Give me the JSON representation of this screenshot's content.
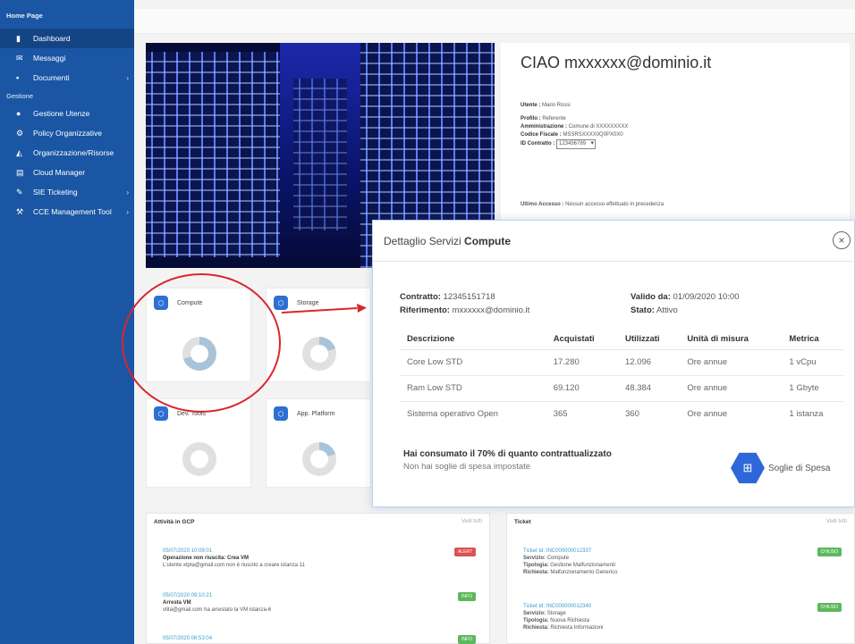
{
  "sidebar": {
    "brand": "Home Page",
    "items_top": [
      {
        "label": "Dashboard",
        "icon": "bar-chart-icon",
        "chevron": ""
      },
      {
        "label": "Messaggi",
        "icon": "envelope-icon",
        "chevron": ""
      },
      {
        "label": "Documenti",
        "icon": "document-icon",
        "chevron": "›"
      }
    ],
    "section": "Gestione",
    "items_bottom": [
      {
        "label": "Gestione Utenze",
        "icon": "user-icon",
        "chevron": ""
      },
      {
        "label": "Policy Organizzative",
        "icon": "policy-icon",
        "chevron": ""
      },
      {
        "label": "Organizzazione/Risorse",
        "icon": "org-icon",
        "chevron": ""
      },
      {
        "label": "Cloud Manager",
        "icon": "server-icon",
        "chevron": ""
      },
      {
        "label": "SIE Ticketing",
        "icon": "wrench-icon",
        "chevron": "›"
      },
      {
        "label": "CCE Management Tool",
        "icon": "tools-icon",
        "chevron": "›"
      }
    ]
  },
  "welcome": {
    "greeting": "CIAO mxxxxxx@dominio.it",
    "utente_label": "Utente :",
    "utente_value": "Mario Rossi",
    "profilo_label": "Profilo :",
    "profilo_value": "Referente",
    "amm_label": "Amministrazione :",
    "amm_value": "Comune di XXXXXXXXX",
    "cf_label": "Codice Fiscale :",
    "cf_value": "MSSRSXXXX0Q0PX0X0",
    "contratto_label": "ID Contratto :",
    "contratto_value": "123456789",
    "accesso_label": "Ultimo Accesso :",
    "accesso_value": "Nessun accesso effettuato in precedenza"
  },
  "cards": [
    {
      "title": "Compute",
      "icon": "compute-icon",
      "fill": 0.7
    },
    {
      "title": "Storage",
      "icon": "storage-icon",
      "fill": 0.2
    },
    {
      "title": "Dev. Tools",
      "icon": "dev-tools-icon",
      "fill": 0.0
    },
    {
      "title": "App. Platform",
      "icon": "app-platform-icon",
      "fill": 0.2
    }
  ],
  "activity": {
    "title": "Attività in GCP",
    "link": "Vedi tutti",
    "items": [
      {
        "when": "05/07/2020 10:09:01",
        "title": "Operazione non riuscita: Crea VM",
        "desc": "L'utente xtpta@gmail.com non è riuscito a creare istanza 11",
        "badge": "ALERT",
        "badge_color": "#d9534f"
      },
      {
        "when": "05/07/2020 09:10:21",
        "title": "Arresta VM",
        "desc": "vtita@gmail.com ha arrestato la VM istanza-6",
        "badge": "INFO",
        "badge_color": "#5cb85c"
      },
      {
        "when": "05/07/2020 08:53:04",
        "title": "",
        "desc": "",
        "badge": "INFO",
        "badge_color": "#5cb85c"
      }
    ]
  },
  "tickets": {
    "title": "Ticket",
    "link": "Vedi tutti",
    "items": [
      {
        "id": "Ticket Id: INC000000012337",
        "servizio_label": "Servizio:",
        "servizio": "Compute",
        "tipologia_label": "Tipologia:",
        "tipologia": "Gestione Malfunzionamenti",
        "richiesta_label": "Richiesta:",
        "richiesta": "Malfunzionamento Generico",
        "badge": "CHIUSO",
        "badge_color": "#5cb85c"
      },
      {
        "id": "Ticket Id: INC000000012340",
        "servizio_label": "Servizio:",
        "servizio": "Storage",
        "tipologia_label": "Tipologia:",
        "tipologia": "Nuova Richiesta",
        "richiesta_label": "Richiesta:",
        "richiesta": "Richiesta Informazioni",
        "badge": "CHIUSO",
        "badge_color": "#5cb85c"
      }
    ]
  },
  "modal": {
    "title_prefix": "Dettaglio Servizi ",
    "title_bold": "Compute",
    "close": "×",
    "contratto_label": "Contratto:",
    "contratto": "12345151718",
    "riferimento_label": "Riferimento:",
    "riferimento": "mxxxxxx@dominio.it",
    "valido_label": "Valido da:",
    "valido": "01/09/2020 10:00",
    "stato_label": "Stato:",
    "stato": "Attivo",
    "columns": [
      "Descrizione",
      "Acquistati",
      "Utilizzati",
      "Unità di misura",
      "Metrica"
    ],
    "rows": [
      [
        "Core Low STD",
        "17.280",
        "12.096",
        "Ore annue",
        "1 vCpu"
      ],
      [
        "Ram Low STD",
        "69.120",
        "48.384",
        "Ore annue",
        "1 Gbyte"
      ],
      [
        "Sistema operativo Open",
        "365",
        "360",
        "Ore annue",
        "1 istanza"
      ]
    ],
    "summary_line1": "Hai consumato il 70% di quanto contrattualizzato",
    "summary_line2": "Non hai soglie di spesa impostate",
    "soglie_label": "Soglie di Spesa"
  },
  "colors": {
    "sidebar": "#1a56a4",
    "accent": "#2e67d9",
    "highlight": "#d8262f",
    "donut_fill": "#a9c3d8",
    "donut_bg": "#e0e0e0"
  }
}
